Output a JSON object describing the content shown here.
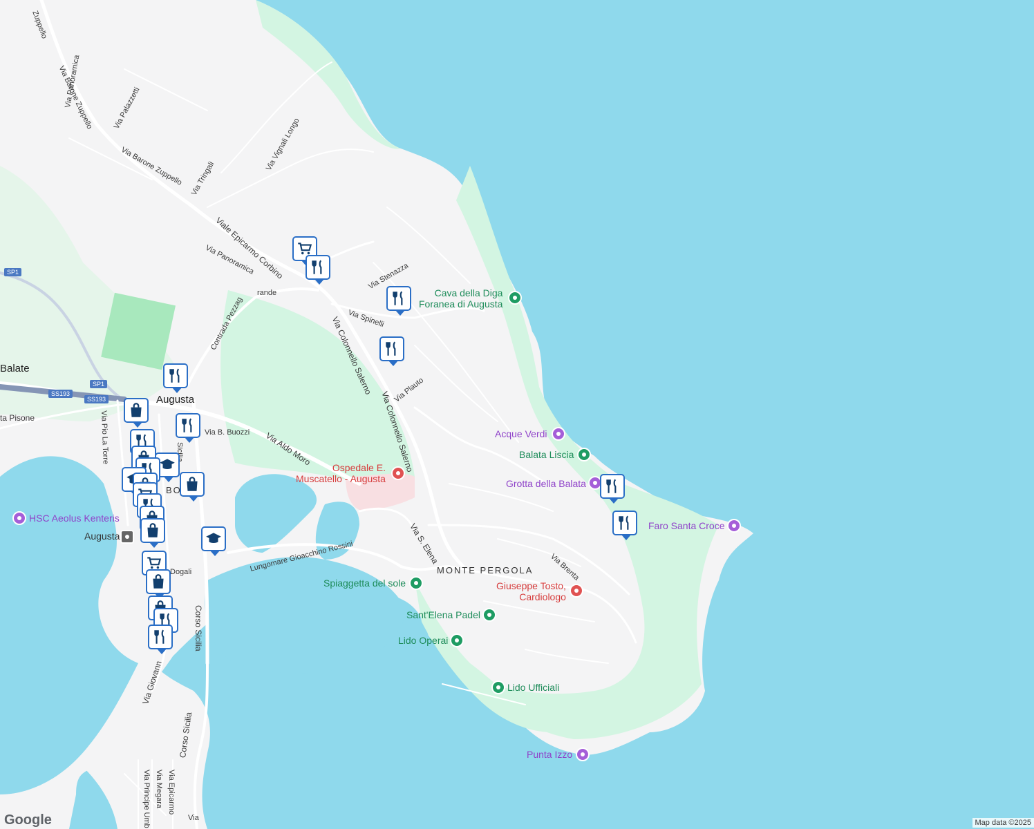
{
  "colors": {
    "water": "#8fd9ec",
    "land": "#f4f4f5",
    "park": "#d3f5e2",
    "road": "#ffffff",
    "accent": "#2a6ec6"
  },
  "pois": {
    "cava": "Cava della Diga\nForanea di Augusta",
    "acque_verdi": "Acque Verdi",
    "balata_liscia": "Balata Liscia",
    "grotta": "Grotta della Balata",
    "faro": "Faro Santa Croce",
    "ospedale": "Ospedale E.\nMuscatello - Augusta",
    "tosto": "Giuseppe Tosto,\nCardiologo",
    "spiaggetta": "Spiaggetta del sole",
    "padel": "Sant'Elena Padel",
    "lido_operai": "Lido Operai",
    "lido_ufficiali": "Lido Ufficiali",
    "punta_izzo": "Punta Izzo",
    "hsc": "HSC Aeolus Kenteris",
    "augusta_station": "Augusta"
  },
  "places": {
    "augusta": "Augusta",
    "balate": "Balate",
    "monte_pergola": "MONTE PERGOLA",
    "borgata": "BO      TA"
  },
  "streets": {
    "zuppello1": "Via Barone Zuppello",
    "zuppello2": "Via Barone Zuppello",
    "zuppello_top": "Zuppello",
    "panoramica1": "Via Panoramica",
    "panoramica2": "Via Panoramica",
    "palazzetti": "Via Palazzetti",
    "tringali": "Via Tringali",
    "vignali": "Via Vignali Longo",
    "epicarmo_corbino": "Viale Epicarmo Corbino",
    "stenazza": "Via Stenazza",
    "spinelli": "Via Spinelli",
    "grande": "rande",
    "pezzagrande": "Contrada Pezzag",
    "salerno1": "Via Colonnello Salerno",
    "salerno2": "Via Colonnello Salerno",
    "plauto": "Via Plauto",
    "aldo_moro": "Via Aldo Moro",
    "buozzi": "Via B. Buozzi",
    "pio": "Via Pio La Torre",
    "pisone": "ta Pisone",
    "sicilia1": "Sicilia",
    "sicilia2": "Corso Sicilia",
    "sicilia3": "Corso Sicilia",
    "rossini": "Lungomare Gioacchino Rossini",
    "elena": "Via S. Elena",
    "brenta": "Via Brenta",
    "dogali": "Dogali",
    "giovanni": "Via Giovann",
    "principe": "Via Principe Umb",
    "megara": "Via Megara",
    "epicarmo": "Via Epicarmo",
    "via": "Via",
    "via_sicilia": "Via Sicilia"
  },
  "shields": {
    "sp1a": "SP1",
    "sp1b": "SP1",
    "ss193a": "SS193",
    "ss193b": "SS193"
  },
  "pin_icons": [
    "restaurant-icon",
    "shopping-cart-icon",
    "shopping-bag-icon",
    "school-icon"
  ],
  "google": "Google",
  "attribution": "Map data ©2025"
}
